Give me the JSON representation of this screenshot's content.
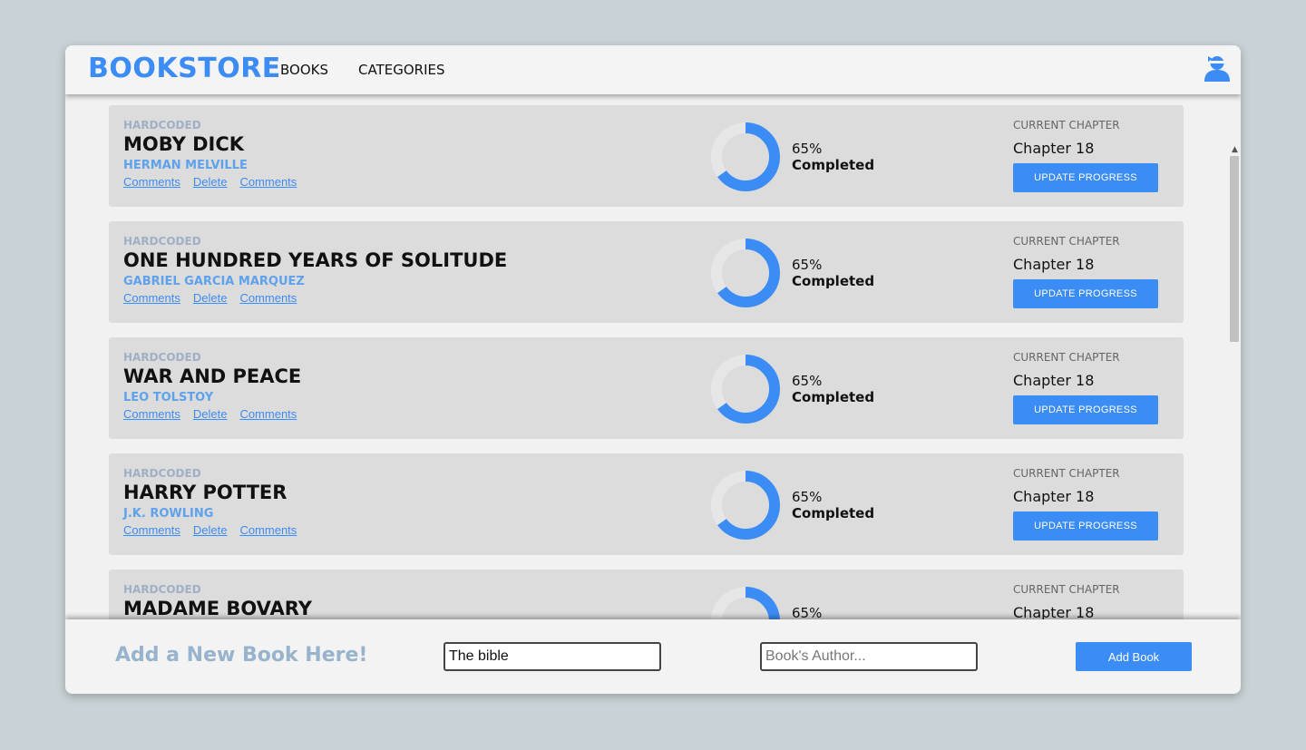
{
  "header": {
    "brand": "BOOKSTORE",
    "nav": [
      "BOOKS",
      "CATEGORIES"
    ]
  },
  "books": [
    {
      "genre": "HARDCODED",
      "title": "MOBY DICK",
      "author": "HERMAN MELVILLE",
      "actions": [
        "Comments",
        "Delete",
        "Comments"
      ],
      "progress_percent": 65,
      "percent_label": "65%",
      "completed_label": "Completed",
      "chapter_label": "CURRENT CHAPTER",
      "chapter": "Chapter 18",
      "update_label": "UPDATE PROGRESS"
    },
    {
      "genre": "HARDCODED",
      "title": "ONE HUNDRED YEARS OF SOLITUDE",
      "author": "GABRIEL GARCIA MARQUEZ",
      "actions": [
        "Comments",
        "Delete",
        "Comments"
      ],
      "progress_percent": 65,
      "percent_label": "65%",
      "completed_label": "Completed",
      "chapter_label": "CURRENT CHAPTER",
      "chapter": "Chapter 18",
      "update_label": "UPDATE PROGRESS"
    },
    {
      "genre": "HARDCODED",
      "title": "WAR AND PEACE",
      "author": "LEO TOLSTOY",
      "actions": [
        "Comments",
        "Delete",
        "Comments"
      ],
      "progress_percent": 65,
      "percent_label": "65%",
      "completed_label": "Completed",
      "chapter_label": "CURRENT CHAPTER",
      "chapter": "Chapter 18",
      "update_label": "UPDATE PROGRESS"
    },
    {
      "genre": "HARDCODED",
      "title": "HARRY POTTER",
      "author": "J.K. ROWLING",
      "actions": [
        "Comments",
        "Delete",
        "Comments"
      ],
      "progress_percent": 65,
      "percent_label": "65%",
      "completed_label": "Completed",
      "chapter_label": "CURRENT CHAPTER",
      "chapter": "Chapter 18",
      "update_label": "UPDATE PROGRESS"
    },
    {
      "genre": "HARDCODED",
      "title": "MADAME BOVARY",
      "author": "",
      "actions": [],
      "progress_percent": 65,
      "percent_label": "65%",
      "completed_label": "",
      "chapter_label": "CURRENT CHAPTER",
      "chapter": "Chapter 18",
      "update_label": ""
    }
  ],
  "footer": {
    "title": "Add a New Book Here!",
    "title_value": "The bible",
    "author_placeholder": "Book's Author...",
    "add_label": "Add Book"
  },
  "colors": {
    "accent": "#3b8cf5",
    "ring_track": "#e6e6e6",
    "card_bg": "#dcdcdc"
  },
  "icons": {
    "user": "user-avatar-icon"
  }
}
